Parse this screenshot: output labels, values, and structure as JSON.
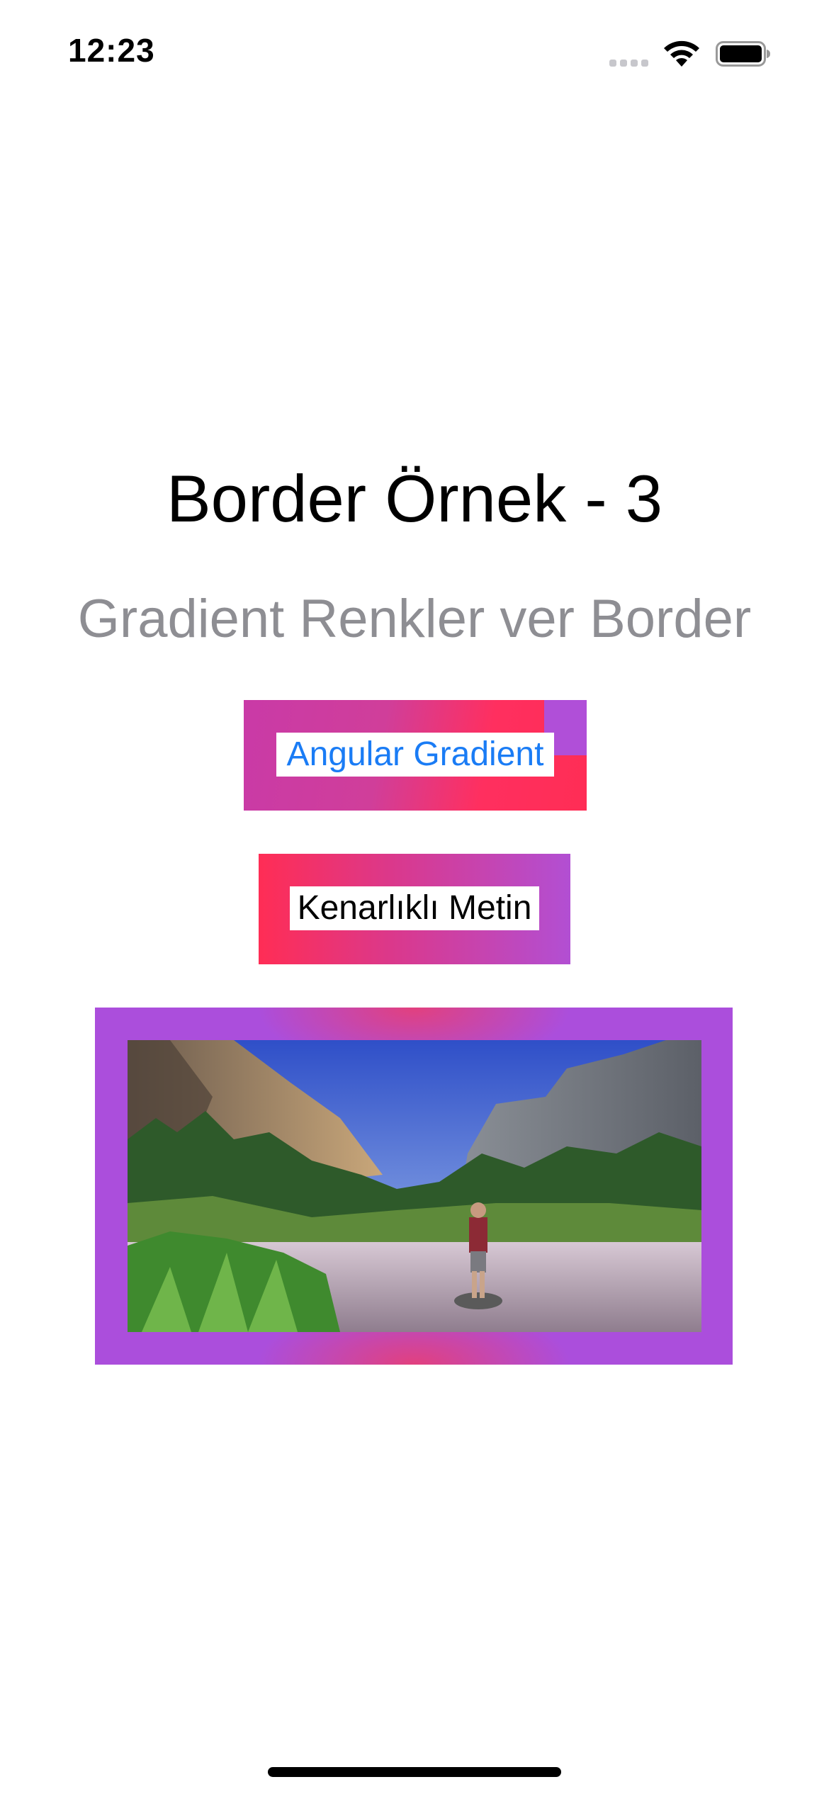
{
  "status_bar": {
    "time": "12:23",
    "icons": [
      "signal-icon",
      "wifi-icon",
      "battery-icon"
    ]
  },
  "title": "Border Örnek - 3",
  "subtitle": "Gradient Renkler ver Border",
  "angular_gradient": {
    "label": "Angular Gradient",
    "text_color": "#1a7cf5",
    "gradient_colors": [
      "#b04fd8",
      "#ff2d55"
    ]
  },
  "bordered_text": {
    "label": "Kenarlıklı Metin",
    "gradient_colors": [
      "#ff2d55",
      "#b24fd3"
    ]
  },
  "image_frame": {
    "image": "landscape-photo",
    "frame_colors": [
      "#ab4edc",
      "#e2407e"
    ]
  },
  "colors": {
    "subtitle": "#8e8e93",
    "title": "#000000",
    "background": "#ffffff"
  }
}
